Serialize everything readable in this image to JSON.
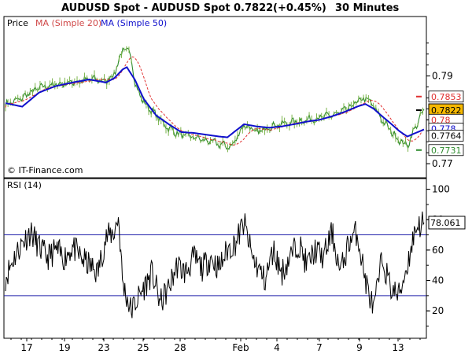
{
  "title": "AUDUSD Spot - AUDUSD Spot",
  "last_price": "0.7822",
  "change": "(+0.45%)",
  "interval": "30 Minutes",
  "watermark": "© IT-Finance.com",
  "colors": {
    "price": "#2e8b2e",
    "ma20": "#e03030",
    "ma50": "#1010cc",
    "rsi": "#000000",
    "rsi_levels": "#2020aa",
    "last_badge": "#f5b800"
  },
  "chart_data": [
    {
      "type": "line",
      "panel": "price",
      "legend": [
        "Price",
        "MA (Simple 20)",
        "MA (Simple 50)"
      ],
      "x_ticks": [
        "17",
        "19",
        "23",
        "25",
        "28",
        "Feb",
        "4",
        "7",
        "9",
        "13"
      ],
      "y_ticks": [
        "0.79",
        "0.78",
        "0.77"
      ],
      "ylim": [
        0.7675,
        0.8005
      ],
      "price_anchors": [
        [
          0,
          0.7835
        ],
        [
          3,
          0.7845
        ],
        [
          6,
          0.7862
        ],
        [
          9,
          0.7876
        ],
        [
          12,
          0.788
        ],
        [
          15,
          0.7885
        ],
        [
          18,
          0.7888
        ],
        [
          21,
          0.7893
        ],
        [
          24,
          0.7888
        ],
        [
          26,
          0.7905
        ],
        [
          28,
          0.796
        ],
        [
          30,
          0.795
        ],
        [
          31,
          0.788
        ],
        [
          33,
          0.784
        ],
        [
          36,
          0.781
        ],
        [
          39,
          0.778
        ],
        [
          42,
          0.7765
        ],
        [
          45,
          0.776
        ],
        [
          48,
          0.7752
        ],
        [
          51,
          0.7745
        ],
        [
          54,
          0.7738
        ],
        [
          57,
          0.779
        ],
        [
          60,
          0.777
        ],
        [
          63,
          0.7785
        ],
        [
          66,
          0.779
        ],
        [
          69,
          0.7795
        ],
        [
          72,
          0.78
        ],
        [
          75,
          0.7805
        ],
        [
          78,
          0.781
        ],
        [
          81,
          0.782
        ],
        [
          84,
          0.784
        ],
        [
          86,
          0.785
        ],
        [
          88,
          0.783
        ],
        [
          90,
          0.78
        ],
        [
          92,
          0.7775
        ],
        [
          94,
          0.7755
        ],
        [
          96,
          0.774
        ],
        [
          98,
          0.7785
        ],
        [
          100,
          0.7822
        ]
      ],
      "ma50_anchors": [
        [
          0,
          0.7838
        ],
        [
          4,
          0.783
        ],
        [
          8,
          0.7862
        ],
        [
          12,
          0.7877
        ],
        [
          16,
          0.7885
        ],
        [
          20,
          0.7892
        ],
        [
          24,
          0.7885
        ],
        [
          26,
          0.7895
        ],
        [
          28,
          0.7915
        ],
        [
          29,
          0.792
        ],
        [
          31,
          0.789
        ],
        [
          33,
          0.7848
        ],
        [
          36,
          0.781
        ],
        [
          39,
          0.779
        ],
        [
          42,
          0.7772
        ],
        [
          45,
          0.777
        ],
        [
          48,
          0.7766
        ],
        [
          51,
          0.7762
        ],
        [
          53,
          0.776
        ],
        [
          55,
          0.7775
        ],
        [
          57,
          0.779
        ],
        [
          60,
          0.7785
        ],
        [
          63,
          0.7782
        ],
        [
          66,
          0.7785
        ],
        [
          69,
          0.779
        ],
        [
          72,
          0.7796
        ],
        [
          75,
          0.78
        ],
        [
          78,
          0.7808
        ],
        [
          81,
          0.7818
        ],
        [
          84,
          0.783
        ],
        [
          86,
          0.7836
        ],
        [
          88,
          0.7825
        ],
        [
          90,
          0.7808
        ],
        [
          92,
          0.7792
        ],
        [
          94,
          0.7775
        ],
        [
          96,
          0.7762
        ],
        [
          98,
          0.777
        ],
        [
          100,
          0.7778
        ]
      ],
      "ma20_lag": 3,
      "right_labels": [
        {
          "text": "0.7853",
          "value": 0.7853,
          "color": "#e03030",
          "marker": "dash"
        },
        {
          "text": "0.7822",
          "value": 0.7822,
          "color": "#000000",
          "marker": "dash",
          "highlight": true
        },
        {
          "text": "0.78",
          "value": 0.78,
          "color": "#e03030",
          "marker": ""
        },
        {
          "text": "0.778",
          "value": 0.778,
          "color": "#1010cc",
          "marker": ""
        },
        {
          "text": "0.7764",
          "value": 0.7764,
          "color": "#000000",
          "marker": ""
        },
        {
          "text": "0.7731",
          "value": 0.7731,
          "color": "#2e8b2e",
          "marker": "dash"
        }
      ]
    },
    {
      "type": "line",
      "panel": "rsi",
      "label": "RSI (14)",
      "y_ticks": [
        "100",
        "80",
        "60",
        "40",
        "20"
      ],
      "ylim": [
        3,
        106
      ],
      "levels": [
        70,
        30
      ],
      "last_value": "78.061",
      "rsi_anchors": [
        [
          0,
          42
        ],
        [
          2,
          55
        ],
        [
          4,
          65
        ],
        [
          6,
          72
        ],
        [
          8,
          62
        ],
        [
          10,
          55
        ],
        [
          12,
          60
        ],
        [
          14,
          55
        ],
        [
          16,
          62
        ],
        [
          18,
          55
        ],
        [
          20,
          50
        ],
        [
          22,
          45
        ],
        [
          24,
          68
        ],
        [
          26,
          72
        ],
        [
          27,
          82
        ],
        [
          28,
          38
        ],
        [
          30,
          20
        ],
        [
          32,
          30
        ],
        [
          35,
          45
        ],
        [
          37,
          25
        ],
        [
          39,
          35
        ],
        [
          41,
          50
        ],
        [
          43,
          45
        ],
        [
          45,
          55
        ],
        [
          47,
          48
        ],
        [
          49,
          55
        ],
        [
          51,
          48
        ],
        [
          53,
          60
        ],
        [
          55,
          65
        ],
        [
          57,
          78
        ],
        [
          59,
          55
        ],
        [
          62,
          40
        ],
        [
          64,
          60
        ],
        [
          66,
          45
        ],
        [
          68,
          55
        ],
        [
          70,
          65
        ],
        [
          72,
          50
        ],
        [
          74,
          60
        ],
        [
          76,
          55
        ],
        [
          78,
          72
        ],
        [
          80,
          45
        ],
        [
          82,
          65
        ],
        [
          84,
          72
        ],
        [
          86,
          40
        ],
        [
          88,
          20
        ],
        [
          90,
          55
        ],
        [
          92,
          35
        ],
        [
          94,
          30
        ],
        [
          96,
          50
        ],
        [
          98,
          75
        ],
        [
          100,
          78
        ]
      ]
    }
  ]
}
